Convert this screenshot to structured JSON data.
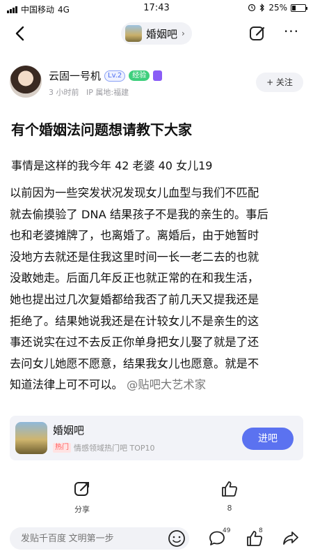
{
  "status_bar": {
    "carrier": "中国移动",
    "network": "4G",
    "time": "17:43",
    "battery": "25%",
    "battery_level": 0.25
  },
  "nav": {
    "forum_name": "婚姻吧",
    "chevron": "›",
    "more": "···"
  },
  "author": {
    "name": "云固一号机",
    "level": "Lv.2",
    "badge": "经验",
    "time": "3 小时前",
    "location": "IP 属地:福建",
    "follow_label": "+ 关注"
  },
  "post": {
    "title": "有个婚姻法问题想请教下大家",
    "intro": "事情是这样的我今年 42 老婆 40 女儿19",
    "lines": [
      "以前因为一些突发状况发现女儿血型与我们不匹配",
      "就去偷摸验了 DNA 结果孩子不是我的亲生的。事后",
      "也和老婆摊牌了，也离婚了。离婚后，由于她暂时",
      "没地方去就还是住我这里时间一长一老二去的也就",
      "没敢她走。后面几年反正也就正常的在和我生活，",
      "她也提出过几次复婚都给我否了前几天又提我还是",
      "拒绝了。结果她说我还是在计较女儿不是亲生的这",
      "事还说实在过不去反正你单身把女儿娶了就是了还",
      "去问女儿她愿不愿意，结果我女儿也愿意。就是不"
    ],
    "last_line": "知道法律上可不可以。",
    "watermark": "@贴吧大艺术家"
  },
  "forum_card": {
    "name": "婚姻吧",
    "hot_label": "热门",
    "subtitle": "情感领域热门吧 TOP10",
    "enter_label": "进吧"
  },
  "actions": {
    "share_label": "分享",
    "like_count": "8"
  },
  "bottom_bar": {
    "reply_placeholder": "发贴千百度 文明第一步",
    "comment_count": "49",
    "like_count": "8"
  },
  "colors": {
    "accent": "#5b72f0",
    "hot_red": "#ff5a5a",
    "badge_green": "#3ecf7d"
  }
}
